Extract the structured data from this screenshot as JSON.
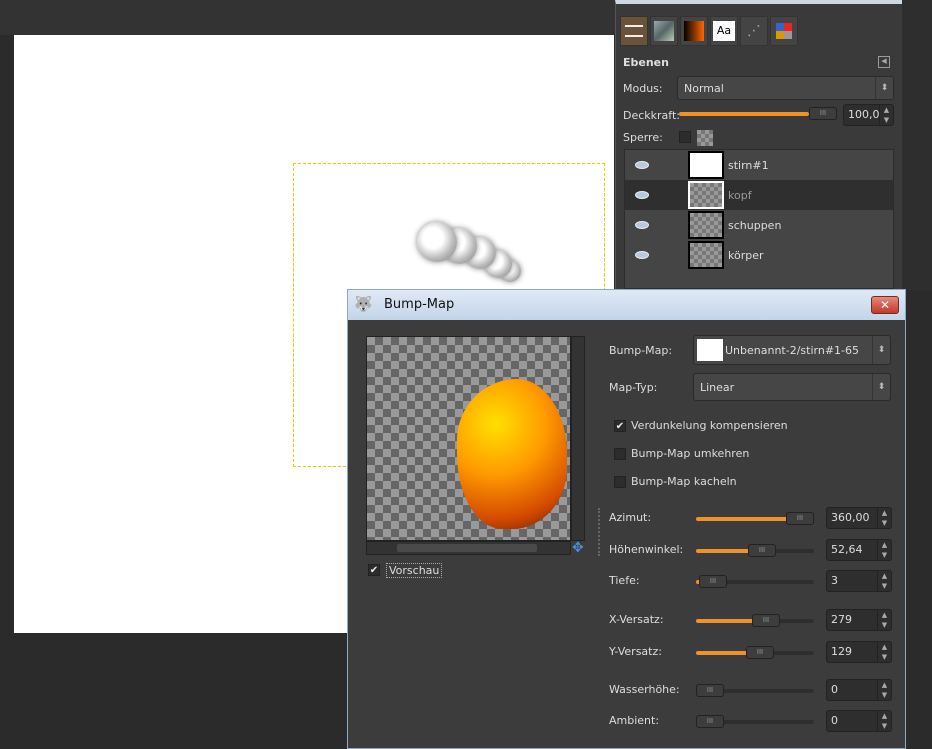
{
  "dock": {
    "tabs": [
      "layers-icon",
      "patterns-icon",
      "gradient-icon",
      "text-Aa",
      "paths-icon",
      "colors-icon"
    ],
    "tab_text": "Aa",
    "title": "Ebenen",
    "mode_label": "Modus:",
    "mode_value": "Normal",
    "opacity_label": "Deckkraft:",
    "opacity_value": "100,0",
    "opacity_fraction": 1.0,
    "lock_label": "Sperre:",
    "layers": [
      {
        "name": "stirn#1",
        "visible": true,
        "selected": false
      },
      {
        "name": "kopf",
        "visible": true,
        "selected": true
      },
      {
        "name": "schuppen",
        "visible": true,
        "selected": false
      },
      {
        "name": "körper",
        "visible": true,
        "selected": false
      }
    ]
  },
  "dialog": {
    "title": "Bump-Map",
    "preview_label": "Vorschau",
    "preview_checked": true,
    "bumpmap_label": "Bump-Map:",
    "bumpmap_value": "Unbenannt-2/stirn#1-65",
    "maptype_label": "Map-Typ:",
    "maptype_value": "Linear",
    "checks": [
      {
        "label": "Verdunkelung kompensieren",
        "checked": true
      },
      {
        "label": "Bump-Map umkehren",
        "checked": false
      },
      {
        "label": "Bump-Map kacheln",
        "checked": false
      }
    ],
    "sliders": [
      {
        "label": "Azimut:",
        "value": "360,00",
        "fraction": 1.0
      },
      {
        "label": "Höhenwinkel:",
        "value": "52,64",
        "fraction": 0.58
      },
      {
        "label": "Tiefe:",
        "value": "3",
        "fraction": 0.03
      },
      {
        "label": "X-Versatz:",
        "value": "279",
        "fraction": 0.62
      },
      {
        "label": "Y-Versatz:",
        "value": "129",
        "fraction": 0.55
      },
      {
        "label": "Wasserhöhe:",
        "value": "0",
        "fraction": 0.0
      },
      {
        "label": "Ambient:",
        "value": "0",
        "fraction": 0.0
      }
    ],
    "accent": "#f0922a"
  }
}
